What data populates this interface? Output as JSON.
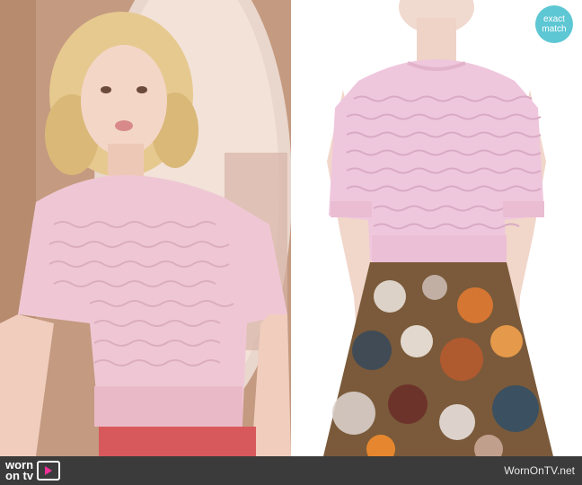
{
  "badge": {
    "line1": "exact",
    "line2": "match"
  },
  "footer": {
    "logo_line1": "worn",
    "logo_line2": "on tv",
    "site": "WornOnTV.net"
  },
  "colors": {
    "sweater": "#efc7d4",
    "badge": "#5ec7d4",
    "footer": "#3b3b3b",
    "logo_accent": "#f0309a"
  }
}
